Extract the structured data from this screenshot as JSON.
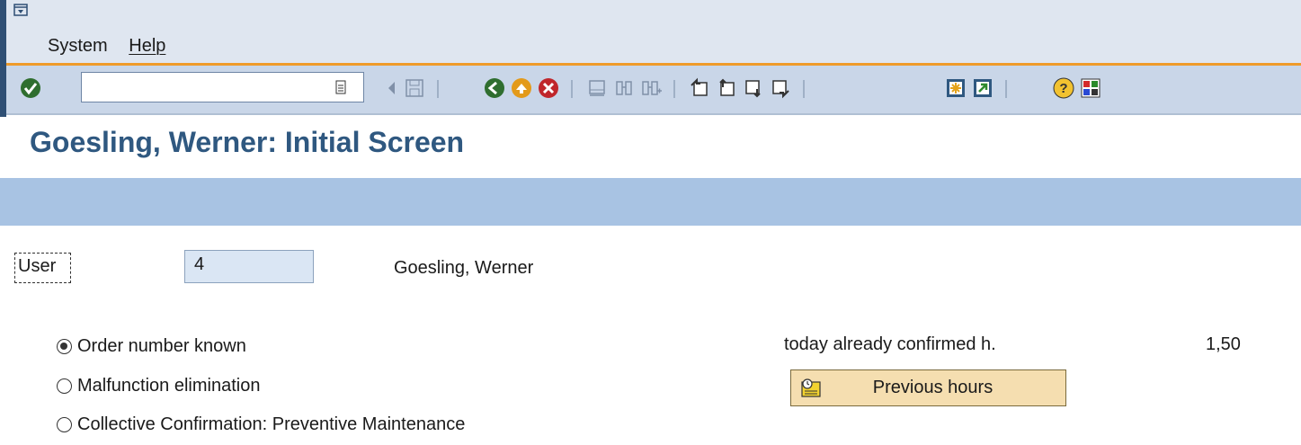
{
  "menu": {
    "items": [
      "System",
      "Help"
    ]
  },
  "toolbar": {
    "command_value": ""
  },
  "page": {
    "title": "Goesling, Werner: Initial Screen"
  },
  "user": {
    "label": "User",
    "value": "4",
    "name": "Goesling, Werner"
  },
  "options": [
    {
      "label": "Order number known",
      "selected": true
    },
    {
      "label": "Malfunction elimination",
      "selected": false
    },
    {
      "label": "Collective Confirmation: Preventive Maintenance",
      "selected": false
    }
  ],
  "confirmed": {
    "label": "today already confirmed h.",
    "value": "1,50"
  },
  "previous_button": {
    "label": "Previous hours"
  },
  "colors": {
    "title": "#2f5880",
    "menubar": "#dfe6f0",
    "toolbar": "#c9d6e8",
    "appbar": "#a8c3e3",
    "accent": "#ef9b2a"
  }
}
